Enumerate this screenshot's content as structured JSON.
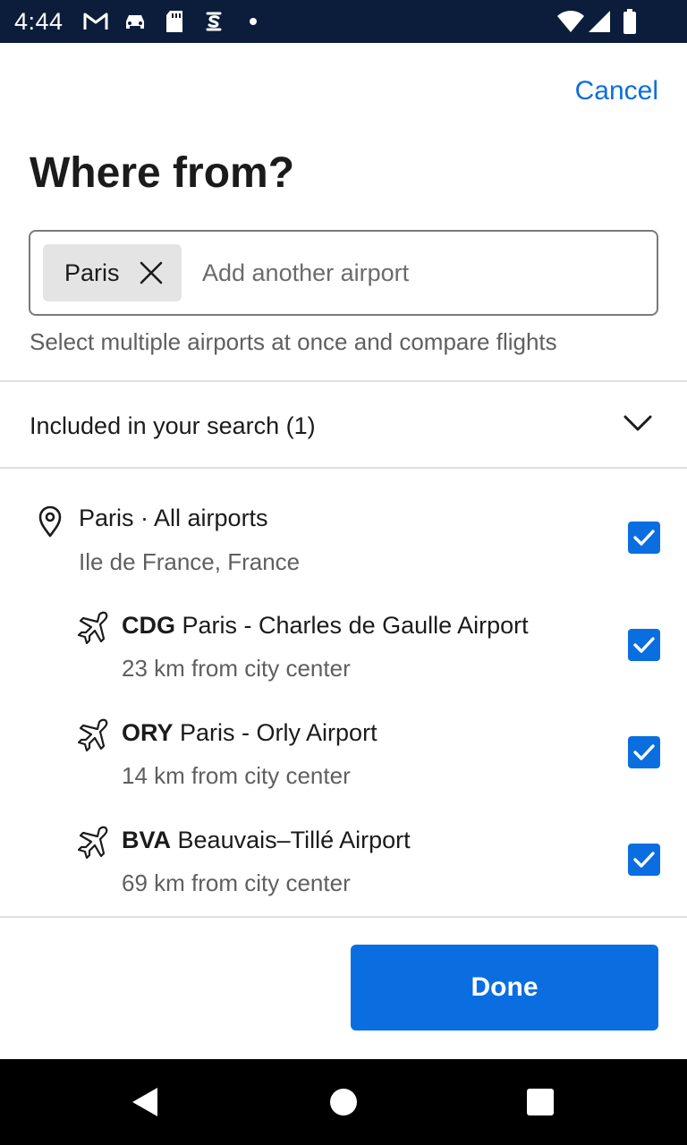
{
  "status_bar": {
    "time": "4:44",
    "left_icons": [
      "gmail-icon",
      "car-icon",
      "sd-card-icon",
      "sync-icon",
      "notification-dot-icon"
    ],
    "right_icons": [
      "wifi-icon",
      "signal-icon",
      "battery-icon"
    ]
  },
  "header": {
    "cancel_label": "Cancel",
    "title": "Where from?"
  },
  "airport_field": {
    "chip_label": "Paris",
    "placeholder": "Add another airport",
    "value": ""
  },
  "helper_text": "Select multiple airports at once and compare flights",
  "included_section": {
    "title": "Included in your search (1)"
  },
  "locations": [
    {
      "icon": "location-pin-icon",
      "code": "",
      "name": "Paris · All airports",
      "subtitle": "Ile de France, France",
      "checked": true
    },
    {
      "icon": "airplane-icon",
      "code": "CDG",
      "name": "Paris - Charles de Gaulle Airport",
      "subtitle": "23 km from city center",
      "checked": true
    },
    {
      "icon": "airplane-icon",
      "code": "ORY",
      "name": "Paris - Orly Airport",
      "subtitle": "14 km from city center",
      "checked": true
    },
    {
      "icon": "airplane-icon",
      "code": "BVA",
      "name": "Beauvais–Tillé Airport",
      "subtitle": "69 km from city center",
      "checked": true
    }
  ],
  "done_label": "Done",
  "colors": {
    "accent": "#0b6ee0",
    "status_bar": "#0b1d3a",
    "chip_bg": "#e4e4e4"
  }
}
